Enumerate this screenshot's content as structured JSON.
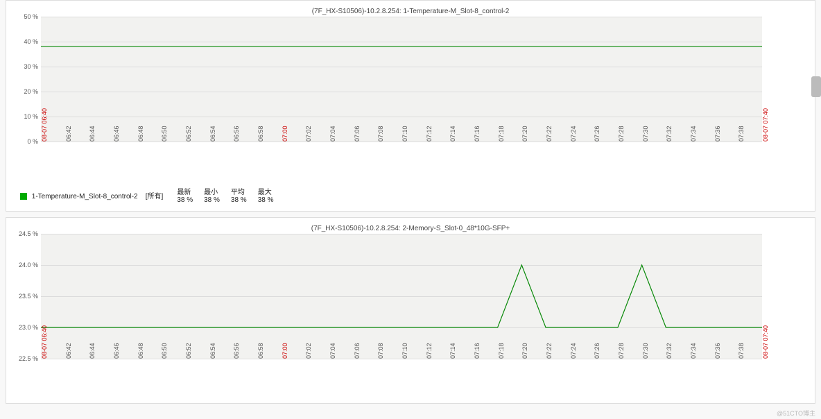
{
  "chart_data": [
    {
      "type": "line",
      "title": "(7F_HX-S10506)-10.2.8.254: 1-Temperature-M_Slot-8_control-2",
      "ylabel": "",
      "xlabel": "",
      "ylim": [
        0,
        50
      ],
      "y_ticks": [
        "0 %",
        "10 %",
        "20 %",
        "30 %",
        "40 %",
        "50 %"
      ],
      "x_start": "08-07 06:40",
      "x_end": "08-07 07:40",
      "x_ticks": [
        "06:40",
        "06:42",
        "06:44",
        "06:46",
        "06:48",
        "06:50",
        "06:52",
        "06:54",
        "06:56",
        "06:58",
        "07:00",
        "07:02",
        "07:04",
        "07:06",
        "07:08",
        "07:10",
        "07:12",
        "07:14",
        "07:16",
        "07:18",
        "07:20",
        "07:22",
        "07:24",
        "07:26",
        "07:28",
        "07:30",
        "07:32",
        "07:34",
        "07:36",
        "07:38",
        "07:40"
      ],
      "series": [
        {
          "name": "1-Temperature-M_Slot-8_control-2",
          "scope": "[所有]",
          "latest": "38 %",
          "min": "38 %",
          "avg": "38 %",
          "max": "38 %",
          "color": "#0a8a0a",
          "values": [
            38,
            38,
            38,
            38,
            38,
            38,
            38,
            38,
            38,
            38,
            38,
            38,
            38,
            38,
            38,
            38,
            38,
            38,
            38,
            38,
            38,
            38,
            38,
            38,
            38,
            38,
            38,
            38,
            38,
            38,
            38
          ]
        }
      ]
    },
    {
      "type": "line",
      "title": "(7F_HX-S10506)-10.2.8.254: 2-Memory-S_Slot-0_48*10G-SFP+",
      "ylabel": "",
      "xlabel": "",
      "ylim": [
        22.5,
        24.5
      ],
      "y_ticks": [
        "22.5 %",
        "23.0 %",
        "23.5 %",
        "24.0 %",
        "24.5 %"
      ],
      "x_start": "08-07 06:40",
      "x_end": "08-07 07:40",
      "x_ticks": [
        "06:40",
        "06:42",
        "06:44",
        "06:46",
        "06:48",
        "06:50",
        "06:52",
        "06:54",
        "06:56",
        "06:58",
        "07:00",
        "07:02",
        "07:04",
        "07:06",
        "07:08",
        "07:10",
        "07:12",
        "07:14",
        "07:16",
        "07:18",
        "07:20",
        "07:22",
        "07:24",
        "07:26",
        "07:28",
        "07:30",
        "07:32",
        "07:34",
        "07:36",
        "07:38",
        "07:40"
      ],
      "series": [
        {
          "name": "2-Memory-S_Slot-0_48*10G-SFP+",
          "color": "#0a8a0a",
          "values": [
            23.0,
            23.0,
            23.0,
            23.0,
            23.0,
            23.0,
            23.0,
            23.0,
            23.0,
            23.0,
            23.0,
            23.0,
            23.0,
            23.0,
            23.0,
            23.0,
            23.0,
            23.0,
            23.0,
            23.0,
            24.0,
            23.0,
            23.0,
            23.0,
            23.0,
            24.0,
            23.0,
            23.0,
            23.0,
            23.0,
            23.0
          ]
        }
      ]
    }
  ],
  "ui": {
    "legend_headers": {
      "latest": "最新",
      "min": "最小",
      "avg": "平均",
      "max": "最大"
    },
    "watermark": "@51CTO博主"
  }
}
